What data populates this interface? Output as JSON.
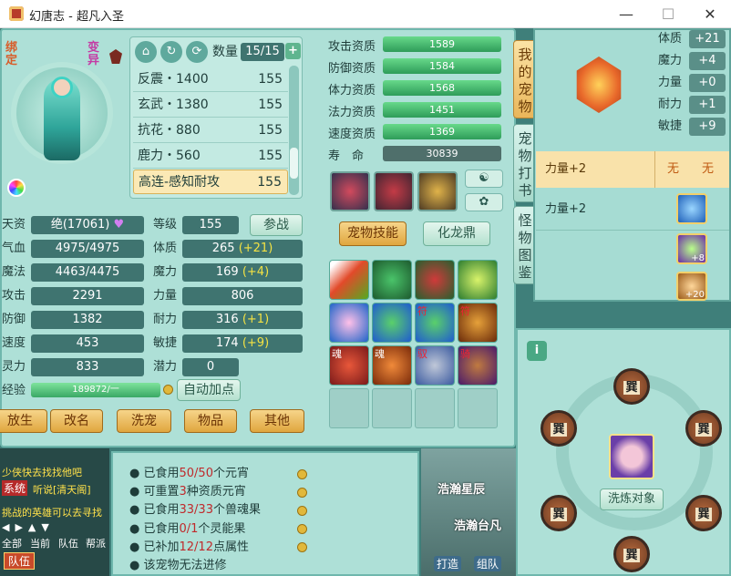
{
  "window": {
    "title": "幻唐志 - 超凡入圣",
    "minimize": "—",
    "maximize": "☐",
    "close": "✕"
  },
  "pet": {
    "bind_label": "绑定",
    "transform_label": "变异"
  },
  "pet_list": {
    "count_label": "数量",
    "count": "15/15",
    "items": [
      {
        "name": "反震・1400",
        "level": "155"
      },
      {
        "name": "玄武・1380",
        "level": "155"
      },
      {
        "name": "抗花・880",
        "level": "155"
      },
      {
        "name": "鹿力・560",
        "level": "155"
      },
      {
        "name": "高连-感知耐攻",
        "level": "155"
      }
    ]
  },
  "aptitudes": [
    {
      "label": "攻击资质",
      "value": "1589"
    },
    {
      "label": "防御资质",
      "value": "1584"
    },
    {
      "label": "体力资质",
      "value": "1568"
    },
    {
      "label": "法力资质",
      "value": "1451"
    },
    {
      "label": "速度资质",
      "value": "1369"
    },
    {
      "label": "寿　命",
      "value": "30839"
    }
  ],
  "stats": {
    "talent_label": "天资",
    "talent_value": "绝(17061)",
    "level_label": "等级",
    "level_value": "155",
    "battle_button": "参战",
    "hp_label": "气血",
    "hp_value": "4975/4975",
    "con_label": "体质",
    "con_value": "265",
    "con_plus": "(+21)",
    "mp_label": "魔法",
    "mp_value": "4463/4475",
    "mag_label": "魔力",
    "mag_value": "169",
    "mag_plus": "(+4)",
    "atk_label": "攻击",
    "atk_value": "2291",
    "str_label": "力量",
    "str_value": "806",
    "def_label": "防御",
    "def_value": "1382",
    "end_label": "耐力",
    "end_value": "316",
    "end_plus": "(+1)",
    "spd_label": "速度",
    "spd_value": "453",
    "agi_label": "敏捷",
    "agi_value": "174",
    "agi_plus": "(+9)",
    "spirit_label": "灵力",
    "spirit_value": "833",
    "pot_label": "潜力",
    "pot_value": "0",
    "exp_label": "经验",
    "exp_value": "189872/一",
    "auto_button": "自动加点"
  },
  "actions": [
    "放生",
    "改名",
    "洗宠",
    "物品",
    "其他"
  ],
  "skill_tabs": {
    "skills": "宠物技能",
    "dragon": "化龙鼎"
  },
  "skill_marks": [
    "",
    "",
    "",
    "",
    "",
    "",
    "符",
    "符",
    "魂",
    "魂",
    "驭",
    "骑"
  ],
  "side_tabs": [
    "我的宠物",
    "宠物打书",
    "怪物图鉴"
  ],
  "right_attrs": [
    {
      "label": "体质",
      "value": "+21"
    },
    {
      "label": "魔力",
      "value": "+4"
    },
    {
      "label": "力量",
      "value": "+0"
    },
    {
      "label": "耐力",
      "value": "+1"
    },
    {
      "label": "敏捷",
      "value": "+9"
    }
  ],
  "refine_rows": [
    {
      "label": "力量+2",
      "col1": "无",
      "col2": "无"
    },
    {
      "label": "力量+2",
      "col1": "",
      "col2": ""
    }
  ],
  "badges": [
    "+8",
    "+20"
  ],
  "wash": {
    "label": "洗炼对象",
    "slot_char": "巽"
  },
  "chat": {
    "lines": [
      "少侠快去找找他吧",
      "系统",
      "听说[清天阁]",
      "挑战的英雄可以去寻找"
    ],
    "tabs": [
      "全部",
      "当前",
      "队伍",
      "帮派"
    ],
    "team": "队伍"
  },
  "food": [
    {
      "pre": "已食用",
      "num": "50/50",
      "post": "个元宵"
    },
    {
      "pre": "可重置",
      "num": "3",
      "post": "种资质元宵"
    },
    {
      "pre": "已食用",
      "num": "33/33",
      "post": "个兽魂果"
    },
    {
      "pre": "已食用",
      "num": "0/1",
      "post": "个灵能果"
    },
    {
      "pre": "已补加",
      "num": "12/12",
      "post": "点属性"
    },
    {
      "pre": "该宠物无法进修",
      "num": "",
      "post": ""
    }
  ],
  "map": {
    "text1": "浩瀚星辰",
    "text2": "浩瀚台凡",
    "btn1": "打造",
    "btn2": "组队"
  },
  "colors": {
    "accent": "#e0a63e",
    "panel": "#aee0d7",
    "highlight": "#c0292b"
  }
}
